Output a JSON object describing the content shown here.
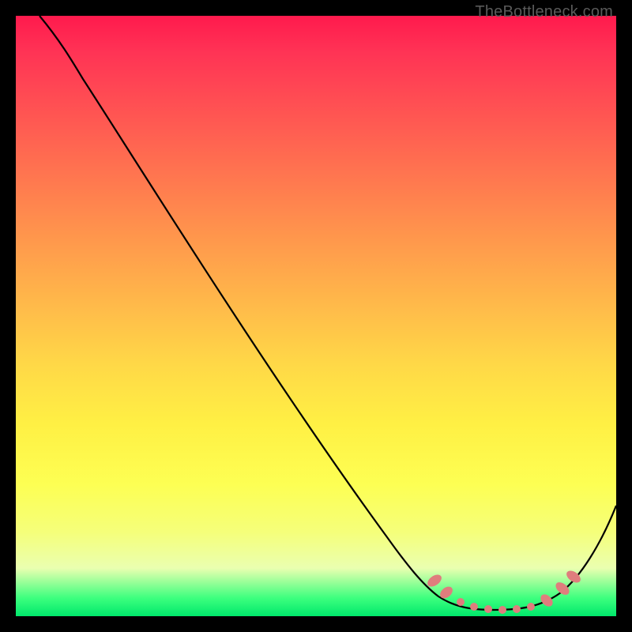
{
  "attribution": "TheBottleneck.com",
  "chart_data": {
    "type": "line",
    "title": "",
    "xlabel": "",
    "ylabel": "",
    "x_range": [
      0,
      100
    ],
    "y_range": [
      0,
      100
    ],
    "series": [
      {
        "name": "bottleneck-curve",
        "x": [
          4,
          8,
          12,
          20,
          30,
          40,
          50,
          60,
          65,
          70,
          75,
          80,
          85,
          90,
          95,
          100
        ],
        "y": [
          100,
          97,
          94,
          85,
          72,
          59,
          46,
          33,
          24,
          14,
          5,
          2,
          2,
          4,
          10,
          20
        ]
      }
    ],
    "markers": {
      "name": "highlight-points",
      "color": "#e07878",
      "x": [
        70,
        72,
        75,
        78,
        80,
        83,
        86,
        88,
        90,
        92
      ],
      "y": [
        7,
        5,
        3,
        2,
        2,
        2,
        2,
        3,
        5,
        8
      ]
    },
    "background_gradient": {
      "top": "#ff1a4d",
      "mid": "#ffd847",
      "bottom": "#00e86b"
    }
  }
}
